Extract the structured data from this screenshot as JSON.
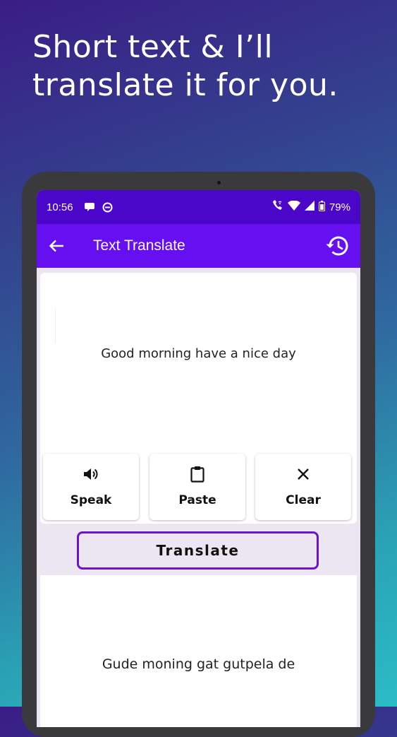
{
  "promo": {
    "headline_line1": "Short text & I’ll",
    "headline_line2": "translate it for you."
  },
  "status_bar": {
    "time": "10:56",
    "battery": "79%"
  },
  "app_bar": {
    "title": "Text Translate"
  },
  "input": {
    "text": "Good morning have a nice day"
  },
  "actions": [
    {
      "label": "Speak",
      "icon": "speaker-icon"
    },
    {
      "label": "Paste",
      "icon": "clipboard-icon"
    },
    {
      "label": "Clear",
      "icon": "close-icon"
    }
  ],
  "translate_button": {
    "label": "Translate"
  },
  "output": {
    "text": "Gude moning gat gutpela de"
  },
  "colors": {
    "status_bar": "#4a06c9",
    "app_bar": "#6610f2",
    "translate_border": "#6a13d0",
    "screen_bg": "#ece6f3"
  }
}
